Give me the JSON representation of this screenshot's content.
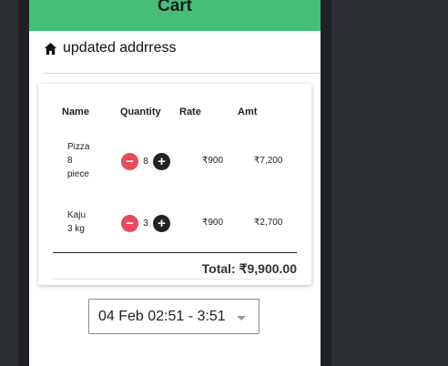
{
  "header": {
    "title": "Cart"
  },
  "address": {
    "icon": "home-icon",
    "text": "updated addrress"
  },
  "table": {
    "columns": [
      "Name",
      "Quantity",
      "Rate",
      "Amt"
    ],
    "rows": [
      {
        "name_lines": [
          "Pizza",
          "8",
          "piece"
        ],
        "qty": "8",
        "rate": "₹900",
        "amt": "₹7,200"
      },
      {
        "name_lines": [
          "Kaju",
          "3 kg"
        ],
        "qty": "3",
        "rate": "₹900",
        "amt": "₹2,700"
      }
    ],
    "total": "Total: ₹9,900.00"
  },
  "time_slot": {
    "value": "04 Feb 02:51 - 3:51"
  },
  "colors": {
    "header": "#46be7a",
    "minus": "#e64a5c",
    "plus": "#222222"
  }
}
